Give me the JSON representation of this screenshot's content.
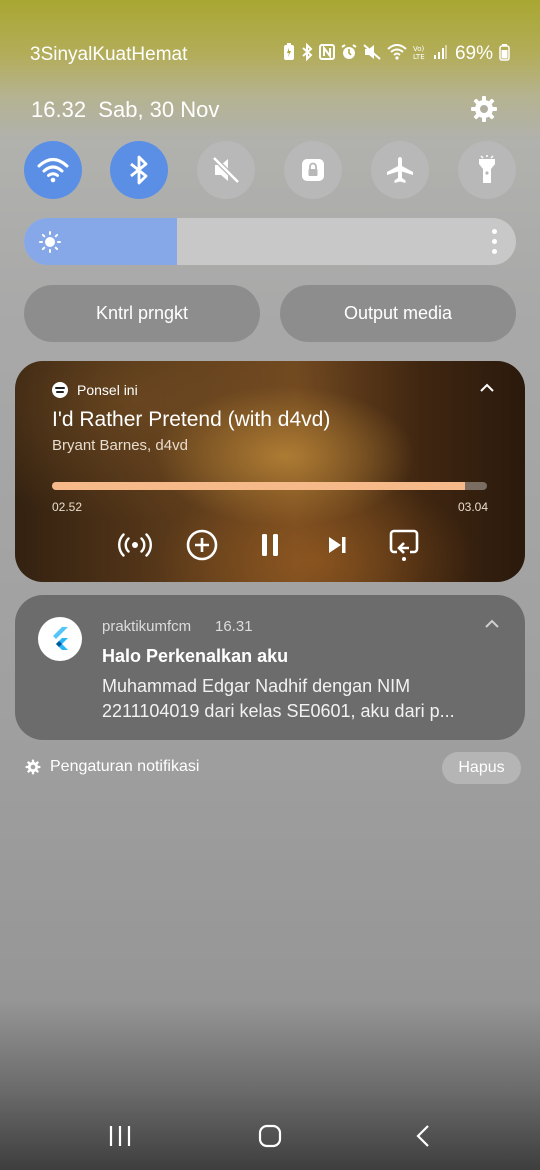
{
  "status_bar": {
    "carrier": "3SinyalKuatHemat",
    "battery_pct": "69%",
    "icons": [
      "battery-saver-icon",
      "bluetooth-icon",
      "nfc-icon",
      "alarm-icon",
      "mute-icon",
      "wifi-icon",
      "volte-icon",
      "signal-icon",
      "battery-icon"
    ]
  },
  "header": {
    "time": "16.32",
    "date": "Sab, 30 Nov",
    "settings_icon": "gear-icon"
  },
  "quick_toggles": [
    {
      "name": "wifi",
      "icon": "wifi-icon",
      "state": "on"
    },
    {
      "name": "bluetooth",
      "icon": "bluetooth-icon",
      "state": "on"
    },
    {
      "name": "sound",
      "icon": "mute-icon",
      "state": "off"
    },
    {
      "name": "rotation-lock",
      "icon": "lock-icon",
      "state": "off"
    },
    {
      "name": "airplane",
      "icon": "airplane-icon",
      "state": "off"
    },
    {
      "name": "flashlight",
      "icon": "flashlight-icon",
      "state": "off"
    }
  ],
  "brightness": {
    "level": 0.31
  },
  "buttons": {
    "device_control": "Kntrl prngkt",
    "media_output": "Output media"
  },
  "media": {
    "source": "Ponsel ini",
    "title": "I'd Rather Pretend (with d4vd)",
    "artist": "Bryant Barnes, d4vd",
    "current_time": "02.52",
    "total_time": "03.04",
    "progress": 0.95,
    "controls": [
      "cast-icon",
      "add-icon",
      "pause-icon",
      "next-icon",
      "output-icon"
    ]
  },
  "notification": {
    "app": "praktikumfcm",
    "time": "16.31",
    "title": "Halo Perkenalkan aku",
    "body": "Muhammad Edgar Nadhif dengan NIM 2211104019 dari kelas SE0601, aku dari p..."
  },
  "footer": {
    "settings_label": "Pengaturan notifikasi",
    "clear_label": "Hapus"
  },
  "colors": {
    "toggle_on": "#5b8fe6",
    "toggle_off": "#b8b8b8",
    "progress_fill": "#f5b98a"
  }
}
